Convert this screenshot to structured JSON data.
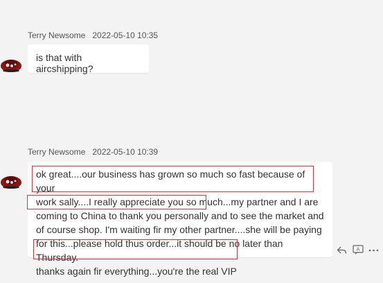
{
  "messages": [
    {
      "sender": "Terry Newsome",
      "timestamp": "2022-05-10 10:35",
      "text": "is that with aircshipping?"
    },
    {
      "sender": "Terry Newsome",
      "timestamp": "2022-05-10 10:39",
      "text": "ok great....our business has grown so much so fast because of your\nwork sally....I really appreciate you so much...my partner and I are\ncoming to China to thank you personally and to see the market and\nof course shop. I'm waiting fir my other partner....she will be paying\nfor this...please hold thus order...it should be no later than Thursday.\nthanks again fir everything...you're the real VIP"
    }
  ],
  "actions": {
    "reply_icon": "reply-icon",
    "translate_icon": "translate-icon",
    "more_icon": "more-icon"
  },
  "colors": {
    "background": "#f3f3f3",
    "bubble": "#ffffff",
    "highlight": "#d9333f"
  }
}
